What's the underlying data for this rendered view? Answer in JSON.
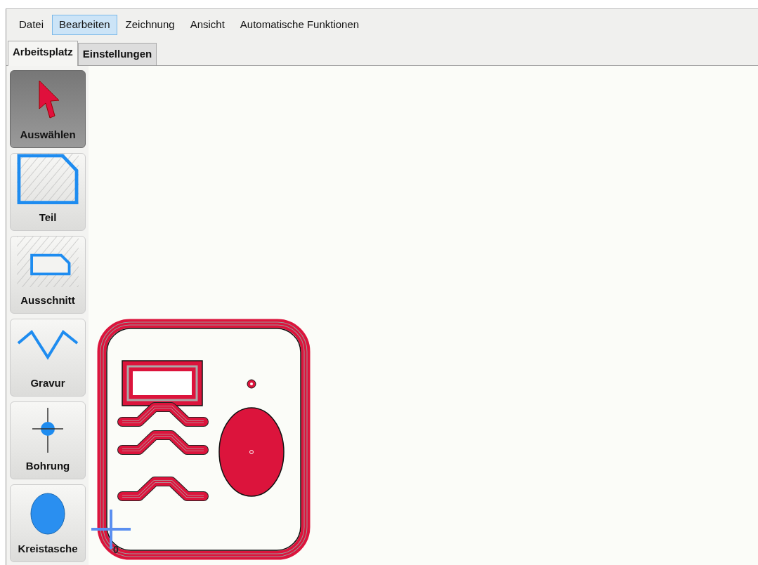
{
  "menu": [
    {
      "label": "Datei",
      "selected": false
    },
    {
      "label": "Bearbeiten",
      "selected": true
    },
    {
      "label": "Zeichnung",
      "selected": false
    },
    {
      "label": "Ansicht",
      "selected": false
    },
    {
      "label": "Automatische Funktionen",
      "selected": false
    }
  ],
  "tabs": [
    {
      "label": "Arbeitsplatz",
      "selected": true
    },
    {
      "label": "Einstellungen",
      "selected": false
    }
  ],
  "tools": [
    {
      "label": "Auswählen",
      "kind": "select",
      "selected": true
    },
    {
      "label": "Teil",
      "kind": "part",
      "selected": false
    },
    {
      "label": "Ausschnitt",
      "kind": "cutout",
      "selected": false
    },
    {
      "label": "Gravur",
      "kind": "engraving",
      "selected": false
    },
    {
      "label": "Bohrung",
      "kind": "drill",
      "selected": false
    },
    {
      "label": "Kreistasche",
      "kind": "pocket",
      "selected": false
    }
  ],
  "canvas": {
    "origin_label": "0"
  }
}
